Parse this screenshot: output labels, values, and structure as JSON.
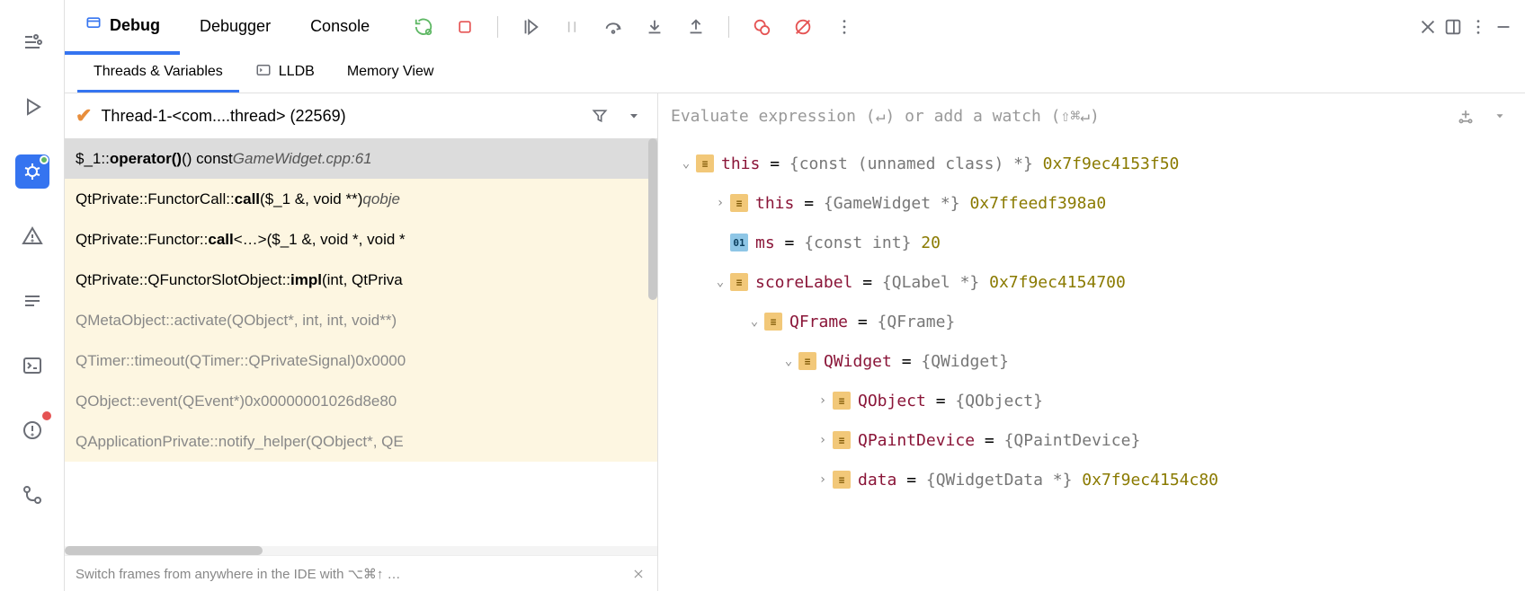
{
  "toolbar": {
    "tabs": [
      {
        "label": "Debug",
        "active": true
      },
      {
        "label": "Debugger",
        "active": false
      },
      {
        "label": "Console",
        "active": false
      }
    ]
  },
  "subtabs": [
    {
      "label": "Threads & Variables",
      "active": true
    },
    {
      "label": "LLDB",
      "active": false
    },
    {
      "label": "Memory View",
      "active": false
    }
  ],
  "thread": {
    "name": "Thread-1-<com....thread> (22569)"
  },
  "frames": [
    {
      "prefix": "$_1::",
      "fn": "operator()",
      "suffix": "() const ",
      "loc": "GameWidget.cpp:61",
      "selected": true,
      "dim": false
    },
    {
      "prefix": "QtPrivate::FunctorCall::",
      "fn": "call",
      "suffix": "($_1 &, void **) ",
      "loc": "qobje",
      "selected": false,
      "dim": false
    },
    {
      "prefix": "QtPrivate::Functor::",
      "fn": "call",
      "suffix": "<…>($_1 &, void *, void *",
      "loc": "",
      "selected": false,
      "dim": false
    },
    {
      "prefix": "QtPrivate::QFunctorSlotObject::",
      "fn": "impl",
      "suffix": "(int, QtPriva",
      "loc": "",
      "selected": false,
      "dim": false
    },
    {
      "prefix": "QMetaObject::activate(QObject*, int, int, void**)",
      "fn": "",
      "suffix": "",
      "loc": "",
      "selected": false,
      "dim": true
    },
    {
      "prefix": "QTimer::timeout(QTimer::QPrivateSignal) ",
      "fn": "",
      "suffix": "",
      "loc": "0x0000",
      "selected": false,
      "dim": true
    },
    {
      "prefix": "QObject::event(QEvent*) ",
      "fn": "",
      "suffix": "",
      "loc": "0x00000001026d8e80",
      "selected": false,
      "dim": true
    },
    {
      "prefix": "QApplicationPrivate::notify_helper(QObject*, QE",
      "fn": "",
      "suffix": "",
      "loc": "",
      "selected": false,
      "dim": true
    }
  ],
  "hint": "Switch frames from anywhere in the IDE with ⌥⌘↑ …",
  "eval_placeholder": "Evaluate expression (↵) or add a watch (⇧⌘↵)",
  "vars": [
    {
      "depth": 0,
      "arrow": "down",
      "icon": "obj",
      "name": "this",
      "type": "{const (unnamed class) *}",
      "val": "0x7f9ec4153f50"
    },
    {
      "depth": 1,
      "arrow": "right",
      "icon": "obj",
      "name": "this",
      "type": "{GameWidget *}",
      "val": "0x7ffeedf398a0"
    },
    {
      "depth": 1,
      "arrow": "blank",
      "icon": "prim",
      "name": "ms",
      "type": "{const int}",
      "val": "20"
    },
    {
      "depth": 1,
      "arrow": "down",
      "icon": "obj",
      "name": "scoreLabel",
      "type": "{QLabel *}",
      "val": "0x7f9ec4154700"
    },
    {
      "depth": 2,
      "arrow": "down",
      "icon": "obj",
      "name": "QFrame",
      "type": "{QFrame}",
      "val": ""
    },
    {
      "depth": 3,
      "arrow": "down",
      "icon": "obj",
      "name": "QWidget",
      "type": "{QWidget}",
      "val": ""
    },
    {
      "depth": 4,
      "arrow": "right",
      "icon": "obj",
      "name": "QObject",
      "type": "{QObject}",
      "val": ""
    },
    {
      "depth": 4,
      "arrow": "right",
      "icon": "obj",
      "name": "QPaintDevice",
      "type": "{QPaintDevice}",
      "val": ""
    },
    {
      "depth": 4,
      "arrow": "right",
      "icon": "obj",
      "name": "data",
      "type": "{QWidgetData *}",
      "val": "0x7f9ec4154c80"
    }
  ]
}
